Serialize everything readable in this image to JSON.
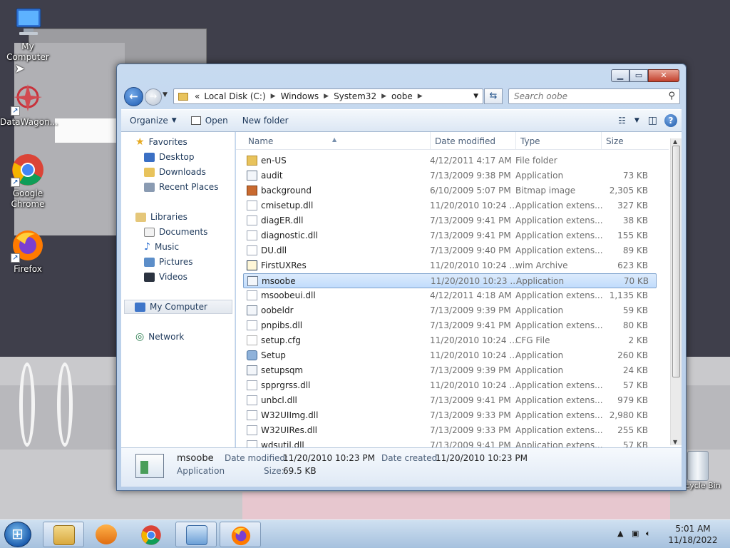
{
  "desktop": {
    "icons": [
      {
        "label": "My Computer",
        "icon": "computer-icon"
      },
      {
        "label": "DataWagon...",
        "icon": "datawagon-icon"
      },
      {
        "label": "Google Chrome",
        "icon": "chrome-icon"
      },
      {
        "label": "Firefox",
        "icon": "firefox-icon"
      },
      {
        "label": "Recycle Bin",
        "icon": "recycle-bin-icon"
      }
    ]
  },
  "window": {
    "caption_buttons": {
      "minimize": "▁",
      "maximize": "▭",
      "close": "✕"
    },
    "address": {
      "overflow": "«",
      "crumbs": [
        "Local Disk (C:)",
        "Windows",
        "System32",
        "oobe"
      ]
    },
    "search": {
      "placeholder": "Search oobe"
    },
    "toolbar": {
      "organize": "Organize",
      "open": "Open",
      "new_folder": "New folder"
    },
    "nav": {
      "favorites": "Favorites",
      "desktop": "Desktop",
      "downloads": "Downloads",
      "recent": "Recent Places",
      "libraries": "Libraries",
      "documents": "Documents",
      "music": "Music",
      "pictures": "Pictures",
      "videos": "Videos",
      "computer": "My Computer",
      "network": "Network"
    },
    "columns": {
      "name": "Name",
      "date": "Date modified",
      "type": "Type",
      "size": "Size"
    },
    "files": [
      {
        "name": "en-US",
        "date": "4/12/2011 4:17 AM",
        "type": "File folder",
        "size": "",
        "kind": "folder"
      },
      {
        "name": "audit",
        "date": "7/13/2009 9:38 PM",
        "type": "Application",
        "size": "73 KB",
        "kind": "app"
      },
      {
        "name": "background",
        "date": "6/10/2009 5:07 PM",
        "type": "Bitmap image",
        "size": "2,305 KB",
        "kind": "img"
      },
      {
        "name": "cmisetup.dll",
        "date": "11/20/2010 10:24 ...",
        "type": "Application extens...",
        "size": "327 KB",
        "kind": "dll"
      },
      {
        "name": "diagER.dll",
        "date": "7/13/2009 9:41 PM",
        "type": "Application extens...",
        "size": "38 KB",
        "kind": "dll"
      },
      {
        "name": "diagnostic.dll",
        "date": "7/13/2009 9:41 PM",
        "type": "Application extens...",
        "size": "155 KB",
        "kind": "dll"
      },
      {
        "name": "DU.dll",
        "date": "7/13/2009 9:40 PM",
        "type": "Application extens...",
        "size": "89 KB",
        "kind": "dll"
      },
      {
        "name": "FirstUXRes",
        "date": "11/20/2010 10:24 ...",
        "type": "wim Archive",
        "size": "623 KB",
        "kind": "arch"
      },
      {
        "name": "msoobe",
        "date": "11/20/2010 10:23 ...",
        "type": "Application",
        "size": "70 KB",
        "kind": "app",
        "selected": true
      },
      {
        "name": "msoobeui.dll",
        "date": "4/12/2011 4:18 AM",
        "type": "Application extens...",
        "size": "1,135 KB",
        "kind": "dll"
      },
      {
        "name": "oobeldr",
        "date": "7/13/2009 9:39 PM",
        "type": "Application",
        "size": "59 KB",
        "kind": "app"
      },
      {
        "name": "pnpibs.dll",
        "date": "7/13/2009 9:41 PM",
        "type": "Application extens...",
        "size": "80 KB",
        "kind": "dll"
      },
      {
        "name": "setup.cfg",
        "date": "11/20/2010 10:24 ...",
        "type": "CFG File",
        "size": "2 KB",
        "kind": "cfg"
      },
      {
        "name": "Setup",
        "date": "11/20/2010 10:24 ...",
        "type": "Application",
        "size": "260 KB",
        "kind": "setup"
      },
      {
        "name": "setupsqm",
        "date": "7/13/2009 9:39 PM",
        "type": "Application",
        "size": "24 KB",
        "kind": "app"
      },
      {
        "name": "spprgrss.dll",
        "date": "11/20/2010 10:24 ...",
        "type": "Application extens...",
        "size": "57 KB",
        "kind": "dll"
      },
      {
        "name": "unbcl.dll",
        "date": "7/13/2009 9:41 PM",
        "type": "Application extens...",
        "size": "979 KB",
        "kind": "dll"
      },
      {
        "name": "W32UIImg.dll",
        "date": "7/13/2009 9:33 PM",
        "type": "Application extens...",
        "size": "2,980 KB",
        "kind": "dll"
      },
      {
        "name": "W32UIRes.dll",
        "date": "7/13/2009 9:33 PM",
        "type": "Application extens...",
        "size": "255 KB",
        "kind": "dll"
      },
      {
        "name": "wdsutil.dll",
        "date": "7/13/2009 9:41 PM",
        "type": "Application extens...",
        "size": "57 KB",
        "kind": "dll"
      }
    ],
    "details": {
      "name": "msoobe",
      "type": "Application",
      "modified_label": "Date modified:",
      "modified": "11/20/2010 10:23 PM",
      "created_label": "Date created:",
      "created": "11/20/2010 10:23 PM",
      "size_label": "Size:",
      "size": "69.5 KB"
    }
  },
  "taskbar": {
    "time": "5:01 AM",
    "date": "11/18/2022",
    "buttons": [
      "explorer-icon",
      "media-player-icon",
      "chrome-icon",
      "remote-desktop-icon",
      "firefox-icon"
    ]
  },
  "colors": {
    "selection": "#c1dcfc",
    "taskbar": "#a6c1de",
    "window_frame": "#b7cde8"
  }
}
